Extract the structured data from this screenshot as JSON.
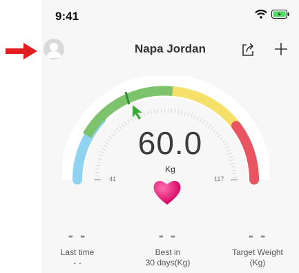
{
  "status": {
    "time": "9:41"
  },
  "header": {
    "title": "Napa Jordan"
  },
  "gauge": {
    "min_label": "41",
    "max_label": "117",
    "value": "60.0",
    "unit": "Kg"
  },
  "stats": [
    {
      "value": "- -",
      "label_line1": "Last time",
      "label_line2": "- -"
    },
    {
      "value": "- -",
      "label_line1": "Best in",
      "label_line2": "30 days(Kg)"
    },
    {
      "value": "- -",
      "label_line1": "Target Weight",
      "label_line2": "(Kg)"
    }
  ],
  "colors": {
    "arc_blue": "#8fd3f0",
    "arc_green": "#7dc36b",
    "arc_yellow": "#f5e06a",
    "arc_red": "#e85460",
    "heart": "#e6207a",
    "arrow": "#e02020"
  }
}
